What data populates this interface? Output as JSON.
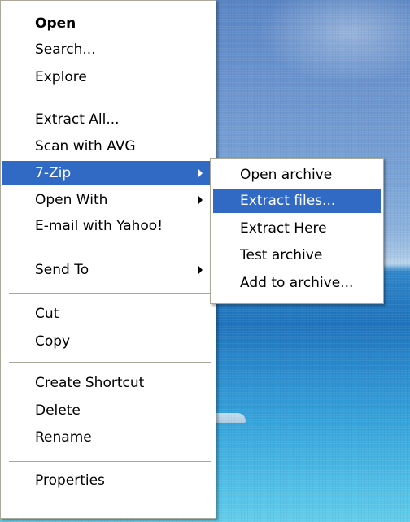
{
  "context_menu": {
    "items": [
      {
        "label": "Open"
      },
      {
        "label": "Search..."
      },
      {
        "label": "Explore"
      },
      {
        "label": "Extract All..."
      },
      {
        "label": "Scan with AVG"
      },
      {
        "label": "7-Zip"
      },
      {
        "label": "Open With"
      },
      {
        "label": "E-mail with Yahoo!"
      },
      {
        "label": "Send To"
      },
      {
        "label": "Cut"
      },
      {
        "label": "Copy"
      },
      {
        "label": "Create Shortcut"
      },
      {
        "label": "Delete"
      },
      {
        "label": "Rename"
      },
      {
        "label": "Properties"
      }
    ]
  },
  "submenu_7zip": {
    "items": [
      {
        "label": "Open archive"
      },
      {
        "label": "Extract files..."
      },
      {
        "label": "Extract Here"
      },
      {
        "label": "Test archive"
      },
      {
        "label": "Add to archive..."
      }
    ]
  },
  "colors": {
    "highlight": "#316ac5",
    "menu_background": "#ffffff",
    "border": "#aca899"
  },
  "icons": {
    "submenu_arrow": "chevron-right-icon"
  }
}
